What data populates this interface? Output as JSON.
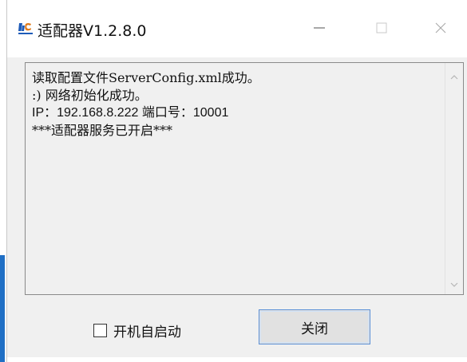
{
  "window": {
    "title": "适配器V1.2.8.0",
    "icon": "app-logo-icon",
    "controls": {
      "minimize": "minimize-icon",
      "maximize": "maximize-icon",
      "close": "close-icon"
    }
  },
  "log": {
    "lines": [
      "读取配置文件ServerConfig.xml成功。",
      ":) 网络初始化成功。",
      "IP：192.168.8.222 端口号：10001",
      "***适配器服务已开启***"
    ]
  },
  "footer": {
    "autostart_label": "开机自启动",
    "autostart_checked": false,
    "close_button_label": "关闭"
  },
  "colors": {
    "accent": "#1f6fc5",
    "button_border": "#5a8fd6",
    "window_bg": "#f0f0f0"
  }
}
